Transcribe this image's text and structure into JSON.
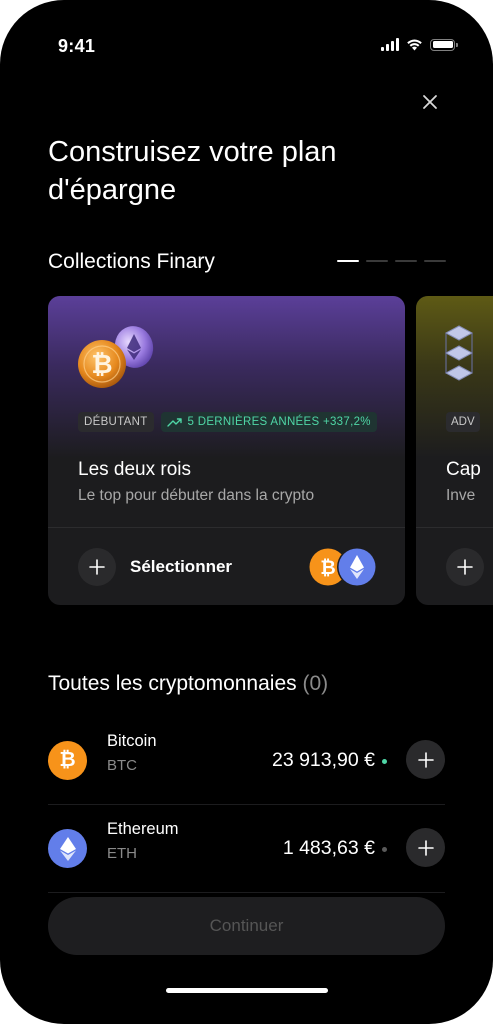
{
  "status_bar": {
    "time": "9:41"
  },
  "header": {
    "close_icon": "close-icon",
    "title": "Construisez votre plan\nd'épargne"
  },
  "collections": {
    "title": "Collections Finary",
    "pager_active_index": 0,
    "pager_count": 4,
    "cards": [
      {
        "level_badge": "DÉBUTANT",
        "performance_badge": "5 DERNIÈRES ANNÉES +337,2%",
        "name": "Les deux rois",
        "description": "Le top pour débuter dans la crypto",
        "select_label": "Sélectionner",
        "coins": [
          "bitcoin-icon",
          "ethereum-icon"
        ]
      },
      {
        "level_badge": "ADV",
        "name": "Cap",
        "description": "Inve"
      }
    ]
  },
  "cryptos": {
    "title": "Toutes les cryptomonnaies",
    "count": "(0)",
    "items": [
      {
        "name": "Bitcoin",
        "symbol": "BTC",
        "price": "23 913,90 €",
        "trend_color": "#4fd6a6",
        "icon_color": "#f7931a"
      },
      {
        "name": "Ethereum",
        "symbol": "ETH",
        "price": "1 483,63 €",
        "trend_color": "#5a5a5a",
        "icon_color": "#627eea"
      }
    ]
  },
  "footer": {
    "continue_label": "Continuer"
  },
  "colors": {
    "background": "#000000",
    "card": "#1c1c1e",
    "accent_green": "#4fd6a6"
  }
}
